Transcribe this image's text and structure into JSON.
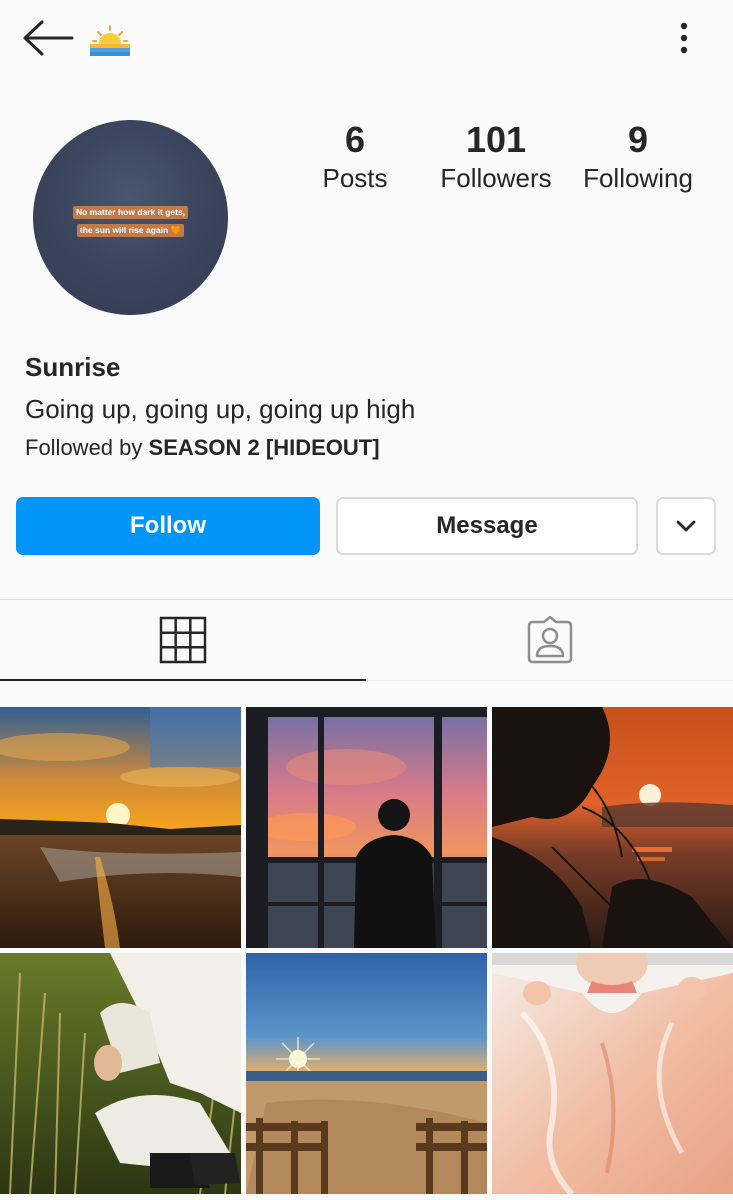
{
  "header": {
    "emoji": "🌅"
  },
  "profile": {
    "name": "Sunrise",
    "bio": "Going up, going up, going up high",
    "followed_by_prefix": "Followed by ",
    "followed_by_name": "SEASON 2 [HIDEOUT]",
    "avatar_quote_line1": "No matter how dark it gets,",
    "avatar_quote_line2": "the sun will rise again 🧡"
  },
  "stats": {
    "posts": {
      "value": "6",
      "label": "Posts"
    },
    "followers": {
      "value": "101",
      "label": "Followers"
    },
    "following": {
      "value": "9",
      "label": "Following"
    }
  },
  "actions": {
    "follow_label": "Follow",
    "message_label": "Message"
  },
  "colors": {
    "accent": "#0095f6",
    "text": "#262626",
    "border": "#dbdbdb",
    "background": "#fafafa"
  },
  "tabs": [
    {
      "name": "grid",
      "icon": "grid-icon",
      "active": true
    },
    {
      "name": "tagged",
      "icon": "tagged-person-icon",
      "active": false
    }
  ],
  "posts": [
    {
      "icon": "sunset-beach-photo"
    },
    {
      "icon": "silhouette-window-photo"
    },
    {
      "icon": "sunset-tree-photo"
    },
    {
      "icon": "white-outfit-grass-photo"
    },
    {
      "icon": "sunrise-boardwalk-photo"
    },
    {
      "icon": "plastic-wrap-photo"
    }
  ]
}
